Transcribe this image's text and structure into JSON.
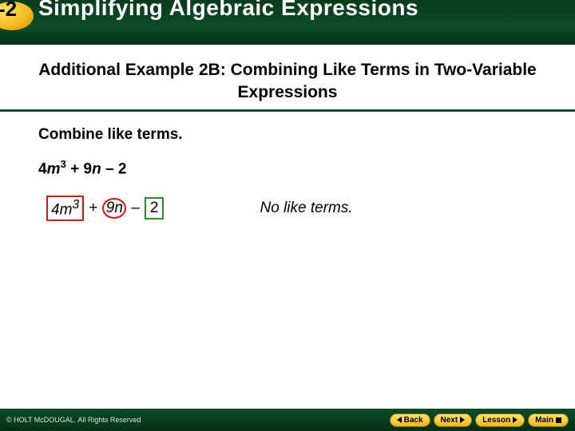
{
  "header": {
    "chapter_number": "-2",
    "chapter_title": "Simplifying Algebraic Expressions"
  },
  "example_heading": "Additional Example 2B: Combining Like Terms in Two-Variable Expressions",
  "instruction": "Combine like terms.",
  "expression": {
    "t1_coef": "4",
    "t1_var": "m",
    "t1_exp": "3",
    "op1": " + ",
    "t2_coef": "9",
    "t2_var": "n",
    "op2": " – ",
    "t3": "2"
  },
  "marked": {
    "t1": "4m",
    "t1_exp": "3",
    "plus": "+",
    "t2": "9n",
    "minus": "–",
    "t3": "2"
  },
  "note": "No like terms.",
  "footer": {
    "copyright": "© HOLT McDOUGAL. All Rights Reserved",
    "back": "Back",
    "next": "Next",
    "lesson": "Lesson",
    "main": "Main"
  }
}
